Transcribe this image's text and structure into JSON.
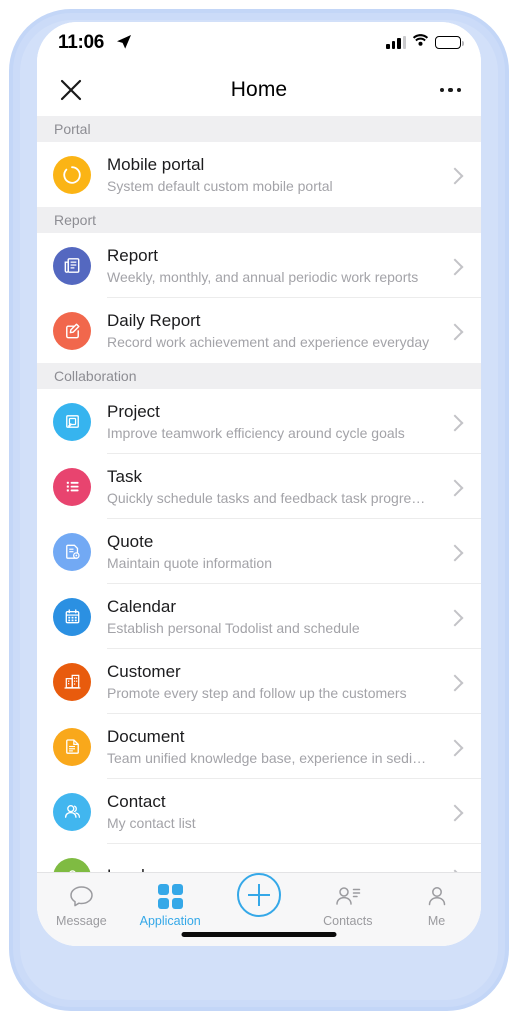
{
  "status_bar": {
    "time": "11:06",
    "location_icon": "location-arrow-icon",
    "signal_icon": "cellular-signal-icon",
    "wifi_icon": "wifi-icon",
    "battery_icon": "battery-full-icon"
  },
  "nav": {
    "close_icon": "close-icon",
    "title": "Home",
    "more_icon": "more-options-icon"
  },
  "sections": [
    {
      "header": "Portal",
      "items": [
        {
          "title": "Mobile portal",
          "subtitle": "System default custom mobile portal",
          "icon": "mobile-portal-icon",
          "color": "#FBB415"
        }
      ]
    },
    {
      "header": "Report",
      "items": [
        {
          "title": "Report",
          "subtitle": "Weekly, monthly, and annual periodic work reports",
          "icon": "report-document-icon",
          "color": "#5468C0"
        },
        {
          "title": "Daily Report",
          "subtitle": "Record work achievement and experience everyday",
          "icon": "daily-report-edit-icon",
          "color": "#F1674C"
        }
      ]
    },
    {
      "header": "Collaboration",
      "items": [
        {
          "title": "Project",
          "subtitle": "Improve teamwork efficiency around cycle goals",
          "icon": "project-layers-icon",
          "color": "#36B4EF"
        },
        {
          "title": "Task",
          "subtitle": "Quickly schedule tasks and feedback task progre…",
          "icon": "task-list-icon",
          "color": "#E8446F"
        },
        {
          "title": "Quote",
          "subtitle": "Maintain quote information",
          "icon": "quote-document-icon",
          "color": "#72A9F4"
        },
        {
          "title": "Calendar",
          "subtitle": "Establish personal Todolist and schedule",
          "icon": "calendar-icon",
          "color": "#2B90E2"
        },
        {
          "title": "Customer",
          "subtitle": "Promote every step and follow up the customers",
          "icon": "customer-building-icon",
          "color": "#E85B0D"
        },
        {
          "title": "Document",
          "subtitle": "Team unified knowledge base, experience in sedi…",
          "icon": "document-icon",
          "color": "#F9A81B"
        },
        {
          "title": "Contact",
          "subtitle": "My contact list",
          "icon": "contact-people-icon",
          "color": "#41B6EF"
        },
        {
          "title": "Lead",
          "subtitle": "",
          "icon": "lead-icon",
          "color": "#7FBB42"
        }
      ]
    }
  ],
  "tab_bar": {
    "tabs": [
      {
        "label": "Message",
        "icon": "message-bubble-icon",
        "active": false
      },
      {
        "label": "Application",
        "icon": "application-grid-icon",
        "active": true
      },
      {
        "label": "",
        "icon": "add-plus-icon",
        "active": false
      },
      {
        "label": "Contacts",
        "icon": "contacts-icon",
        "active": false
      },
      {
        "label": "Me",
        "icon": "profile-person-icon",
        "active": false
      }
    ]
  },
  "colors": {
    "accent": "#35A8E8",
    "section_header_bg": "#EFEFF1",
    "section_header_text": "#8D8D93",
    "subtitle_text": "#A3A3A8",
    "frame": "#C3D6F7"
  }
}
